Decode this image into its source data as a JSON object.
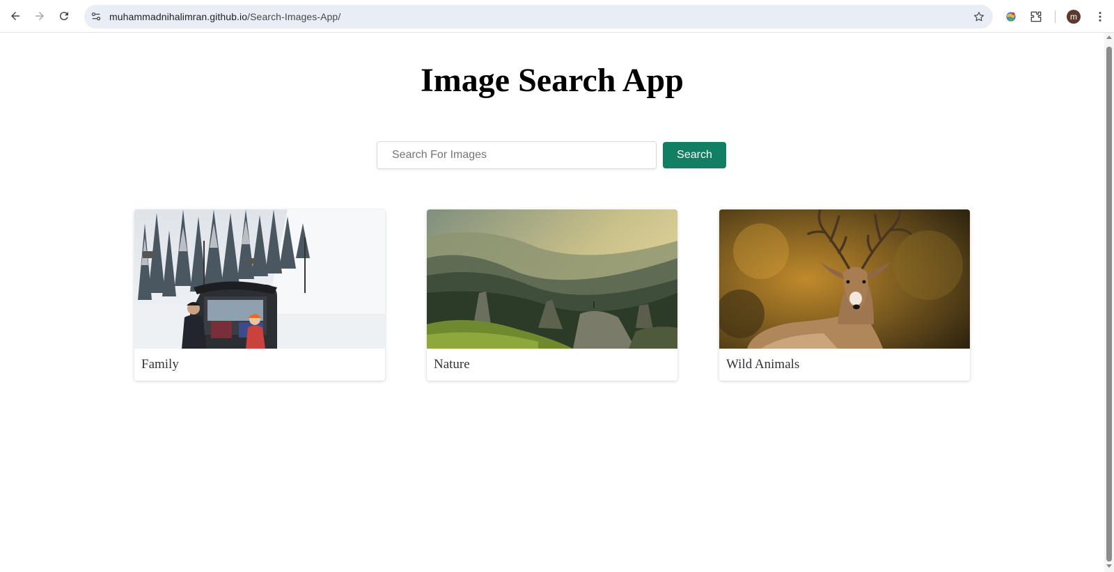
{
  "browser": {
    "url_host": "muhammadnihalimran.github.io",
    "url_path": "/Search-Images-App/",
    "avatar_letter": "m",
    "icons": [
      "back-icon",
      "forward-icon",
      "reload-icon",
      "site-info-icon",
      "bookmark-star-icon",
      "extension-colorful-icon",
      "extensions-puzzle-icon",
      "kebab-menu-icon"
    ]
  },
  "page": {
    "title": "Image Search App",
    "search": {
      "placeholder": "Search For Images",
      "value": "",
      "button_label": "Search"
    },
    "results": [
      {
        "label": "Family",
        "image": "family-snow-car"
      },
      {
        "label": "Nature",
        "image": "mountain-valley"
      },
      {
        "label": "Wild Animals",
        "image": "deer-buck"
      }
    ]
  },
  "colors": {
    "accent": "#127f62",
    "omnibox_bg": "#e9eef6"
  }
}
